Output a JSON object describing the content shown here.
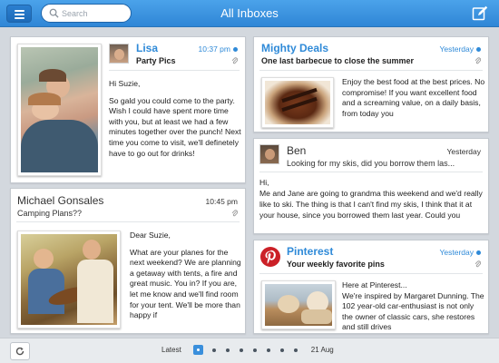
{
  "header": {
    "title": "All Inboxes",
    "search_placeholder": "Search"
  },
  "messages": [
    {
      "sender": "Lisa",
      "time": "10:37 pm",
      "unread": true,
      "subject": "Party Pics",
      "body": [
        "Hi Suzie,",
        "So gald you could come to the party. Wish I could have spent more time with you, but at least we had a few minutes together over the punch! Next time you come to visit, we'll definetely have to go out for drinks!"
      ]
    },
    {
      "sender": "Mighty Deals",
      "time": "Yesterday",
      "unread": true,
      "subject": "One last barbecue to close the summer",
      "body": "Enjoy the best food at the best prices. No compromise! If you want excellent food and a screaming value, on a daily basis, from today you"
    },
    {
      "sender": "Ben",
      "time": "Yesterday",
      "unread": false,
      "subject": "Looking for my skis, did you borrow them las...",
      "body": [
        "Hi,",
        "Me and Jane are going to grandma this weekend and we'd really like to ski. The thing is that I can't find my skis, I think that it at your house, since you borrowed them last year. Could you"
      ]
    },
    {
      "sender": "Michael Gonsales",
      "time": "10:45 pm",
      "unread": false,
      "subject": "Camping Plans??",
      "body": [
        "Dear Suzie,",
        "What are your planes for the next weekend? We are planning a getaway with tents, a fire and great music. You in? If you are, let me know and we'll find room for your tent. We'll be more than happy if"
      ]
    },
    {
      "sender": "Pinterest",
      "time": "Yesterday",
      "unread": true,
      "subject": "Your weekly favorite pins",
      "body": [
        "Here at Pinterest...",
        "We're inspired by Margaret Dunning. The 102 year-old car-enthusiast is not only the owner of classic cars, she restores and still drives"
      ]
    }
  ],
  "footer": {
    "latest_label": "Latest",
    "date_label": "21 Aug",
    "page_count": 8,
    "current_page": 1
  },
  "colors": {
    "accent": "#2f8ad8",
    "topbar": "#3c95e0",
    "pinterest": "#cb2027"
  },
  "icons": [
    "menu-icon",
    "search-icon",
    "compose-icon",
    "attachment-icon",
    "refresh-icon"
  ]
}
